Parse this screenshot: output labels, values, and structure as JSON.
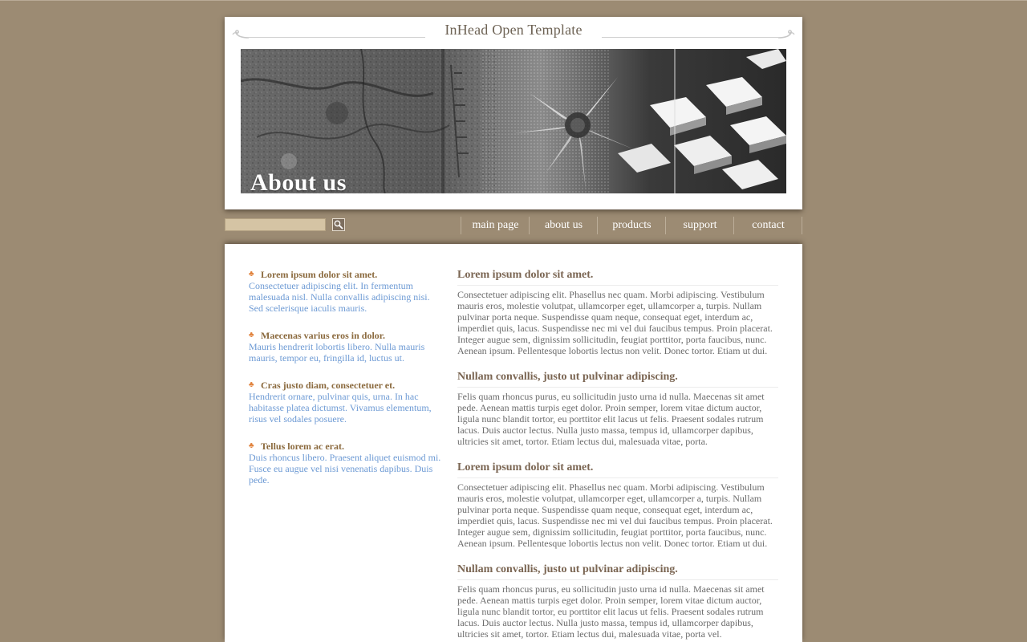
{
  "header": {
    "site_title": "InHead Open Template",
    "banner_caption": "About us"
  },
  "search": {
    "value": "",
    "button_icon": "search-icon"
  },
  "nav": {
    "items": [
      "main page",
      "about us",
      "products",
      "support",
      "contact"
    ]
  },
  "sidebar": {
    "items": [
      {
        "title": "Lorem ipsum dolor sit amet.",
        "text": "Consectetuer adipiscing elit. In fermentum malesuada nisl. Nulla convallis adipiscing nisi. Sed scelerisque iaculis mauris."
      },
      {
        "title": "Maecenas varius eros in dolor.",
        "text": "Mauris hendrerit lobortis libero. Nulla mauris mauris, tempor eu, fringilla id, luctus ut."
      },
      {
        "title": "Cras justo diam, consectetuer et.",
        "text": "Hendrerit ornare, pulvinar quis, urna. In hac habitasse platea dictumst. Vivamus elementum, risus vel sodales posuere."
      },
      {
        "title": "Tellus lorem ac erat.",
        "text": "Duis rhoncus libero. Praesent aliquet euismod mi. Fusce eu augue vel nisi venenatis dapibus. Duis pede."
      }
    ]
  },
  "main": {
    "articles": [
      {
        "title": "Lorem ipsum dolor sit amet.",
        "text": "Consectetuer adipiscing elit. Phasellus nec quam. Morbi adipiscing. Vestibulum mauris eros, molestie volutpat, ullamcorper eget, ullamcorper a, turpis. Nullam pulvinar porta neque. Suspendisse quam neque, consequat eget, interdum ac, imperdiet quis, lacus. Suspendisse nec mi vel dui faucibus tempus. Proin placerat. Integer augue sem, dignissim sollicitudin, feugiat porttitor, porta faucibus, nunc. Aenean ipsum. Pellentesque lobortis lectus non velit. Donec tortor. Etiam ut dui."
      },
      {
        "title": "Nullam convallis, justo ut pulvinar adipiscing.",
        "text": "Felis quam rhoncus purus, eu sollicitudin justo urna id nulla. Maecenas sit amet pede. Aenean mattis turpis eget dolor. Proin semper, lorem vitae dictum auctor, ligula nunc blandit tortor, eu porttitor elit lacus ut felis. Praesent sodales rutrum lacus. Duis auctor lectus. Nulla justo massa, tempus id, ullamcorper dapibus, ultricies sit amet, tortor. Etiam lectus dui, malesuada vitae, porta."
      },
      {
        "title": "Lorem ipsum dolor sit amet.",
        "text": "Consectetuer adipiscing elit. Phasellus nec quam. Morbi adipiscing. Vestibulum mauris eros, molestie volutpat, ullamcorper eget, ullamcorper a, turpis. Nullam pulvinar porta neque. Suspendisse quam neque, consequat eget, interdum ac, imperdiet quis, lacus. Suspendisse nec mi vel dui faucibus tempus. Proin placerat. Integer augue sem, dignissim sollicitudin, feugiat porttitor, porta faucibus, nunc. Aenean ipsum. Pellentesque lobortis lectus non velit. Donec tortor. Etiam ut dui."
      },
      {
        "title": "Nullam convallis, justo ut pulvinar adipiscing.",
        "text": "Felis quam rhoncus purus, eu sollicitudin justo urna id nulla. Maecenas sit amet pede. Aenean mattis turpis eget dolor. Proin semper, lorem vitae dictum auctor, ligula nunc blandit tortor, eu porttitor elit lacus ut felis. Praesent sodales rutrum lacus. Duis auctor lectus. Nulla justo massa, tempus id, ullamcorper dapibus, ultricies sit amet, tortor. Etiam lectus dui, malesuada vitae, porta vel."
      }
    ]
  },
  "colors": {
    "background": "#9c8b73",
    "sidebar_title": "#8b6a3e",
    "sidebar_text": "#6d9ad4",
    "article_title": "#7a6552",
    "bullet": "#e0813a"
  }
}
